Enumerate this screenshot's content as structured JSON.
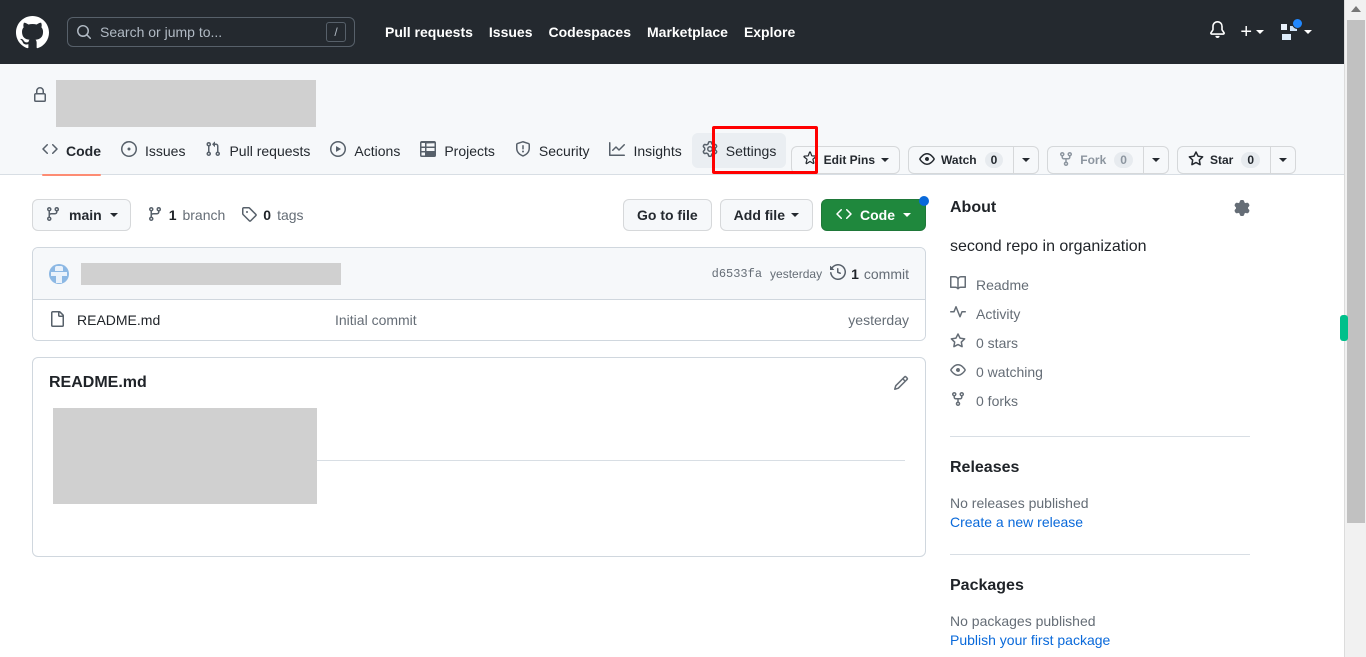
{
  "header": {
    "logo_icon": "github-mark-icon",
    "search": {
      "placeholder": "Search or jump to...",
      "shortcut": "/",
      "icon": "search-icon"
    },
    "nav": [
      {
        "label": "Pull requests"
      },
      {
        "label": "Issues"
      },
      {
        "label": "Codespaces"
      },
      {
        "label": "Marketplace"
      },
      {
        "label": "Explore"
      }
    ],
    "notifications_icon": "bell-icon",
    "create_new_icon": "plus-icon",
    "account_icon": "avatar-icon"
  },
  "repo": {
    "visibility_icon": "lock-icon",
    "name_redacted": true,
    "actions": {
      "edit_pins": {
        "label": "Edit Pins",
        "icon": "pin-star-icon"
      },
      "watch": {
        "label": "Watch",
        "count": "0",
        "icon": "eye-icon"
      },
      "fork": {
        "label": "Fork",
        "count": "0",
        "icon": "fork-icon",
        "disabled": true
      },
      "star": {
        "label": "Star",
        "count": "0",
        "icon": "star-icon"
      }
    },
    "tabs": [
      {
        "label": "Code",
        "icon": "code-icon",
        "active": true
      },
      {
        "label": "Issues",
        "icon": "issue-opened-icon",
        "active": false
      },
      {
        "label": "Pull requests",
        "icon": "git-pull-request-icon",
        "active": false
      },
      {
        "label": "Actions",
        "icon": "play-icon",
        "active": false
      },
      {
        "label": "Projects",
        "icon": "table-icon",
        "active": false
      },
      {
        "label": "Security",
        "icon": "shield-icon",
        "active": false
      },
      {
        "label": "Insights",
        "icon": "graph-icon",
        "active": false
      },
      {
        "label": "Settings",
        "icon": "gear-icon",
        "active": false,
        "highlighted": true
      }
    ]
  },
  "file_toolbar": {
    "branch": {
      "label": "main",
      "icon": "branch-icon"
    },
    "branch_count": {
      "value": "1",
      "label": "branch",
      "icon": "branch-icon"
    },
    "tag_count": {
      "value": "0",
      "label": "tags",
      "icon": "tag-icon"
    },
    "go_to_file": "Go to file",
    "add_file": "Add file",
    "code": "Code"
  },
  "commit_bar": {
    "author_redacted": true,
    "sha": "d6533fa",
    "time": "yesterday",
    "commit_count_value": "1",
    "commit_count_label": "commit",
    "history_icon": "history-icon"
  },
  "files": [
    {
      "name": "README.md",
      "icon": "file-icon",
      "message": "Initial commit",
      "time": "yesterday"
    }
  ],
  "readme": {
    "title": "README.md",
    "edit_icon": "pencil-icon",
    "content_redacted": true
  },
  "about": {
    "title": "About",
    "settings_icon": "gear-icon",
    "description": "second repo in organization",
    "links": [
      {
        "label": "Readme",
        "icon": "book-icon"
      },
      {
        "label": "Activity",
        "icon": "pulse-icon"
      },
      {
        "label": "0 stars",
        "icon": "star-icon",
        "value": "0",
        "noun": "stars"
      },
      {
        "label": "0 watching",
        "icon": "eye-icon",
        "value": "0",
        "noun": "watching"
      },
      {
        "label": "0 forks",
        "icon": "fork-icon",
        "value": "0",
        "noun": "forks"
      }
    ]
  },
  "releases": {
    "title": "Releases",
    "empty_text": "No releases published",
    "action_link": "Create a new release"
  },
  "packages": {
    "title": "Packages",
    "empty_text": "No packages published",
    "action_link": "Publish your first package"
  },
  "colors": {
    "header_bg": "#24292f",
    "accent_green": "#1f883d",
    "link_blue": "#0969da",
    "active_tab_underline": "#fd8c73",
    "highlight_red": "#ff0000",
    "redaction_gray": "#d0d0d0"
  }
}
